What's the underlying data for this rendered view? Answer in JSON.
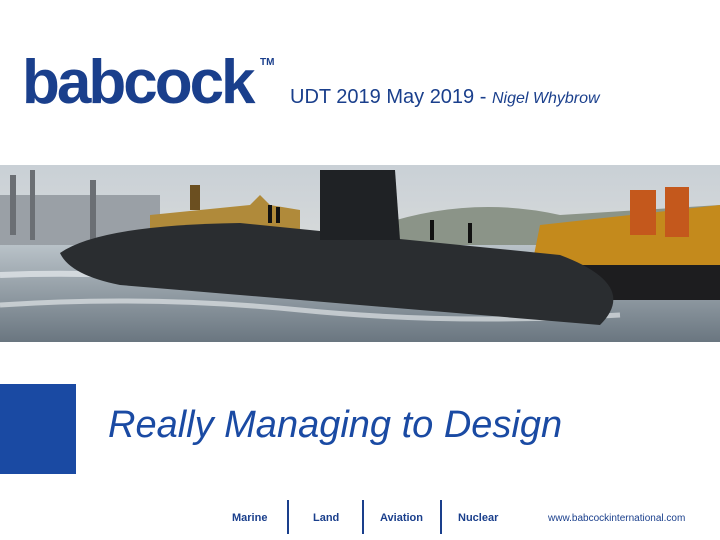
{
  "brand": {
    "logo_text": "babcock",
    "trademark": "TM"
  },
  "header": {
    "event": "UDT 2019 May 2019 -",
    "presenter": "Nigel Whybrow"
  },
  "banner": {
    "image": "submarine-in-harbour"
  },
  "title": "Really Managing to Design",
  "footer": {
    "nav": [
      "Marine",
      "Land",
      "Aviation",
      "Nuclear"
    ],
    "website": "www.babcockinternational.com"
  },
  "colors": {
    "brand_blue": "#1a3f8c",
    "accent_blue": "#1a4aa3"
  }
}
